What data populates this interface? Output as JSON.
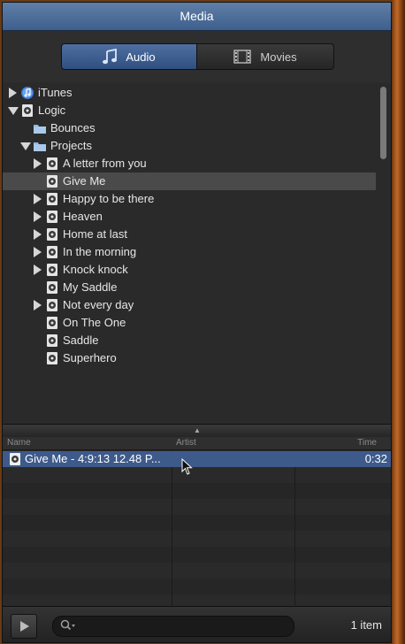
{
  "window": {
    "title": "Media"
  },
  "tabs": {
    "audio_label": "Audio",
    "movies_label": "Movies",
    "selected": "Audio"
  },
  "tree": {
    "items": [
      {
        "label": "iTunes",
        "expander": "collapsed",
        "icon": "itunes-icon",
        "depth": 0
      },
      {
        "label": "Logic",
        "expander": "expanded",
        "icon": "logic-doc-icon",
        "depth": 0
      },
      {
        "label": "Bounces",
        "expander": "none",
        "icon": "folder-icon",
        "depth": 1
      },
      {
        "label": "Projects",
        "expander": "expanded",
        "icon": "folder-icon",
        "depth": 1
      },
      {
        "label": "A letter from you",
        "expander": "collapsed",
        "icon": "logic-doc-icon",
        "depth": 2
      },
      {
        "label": "Give Me",
        "expander": "none",
        "icon": "logic-doc-icon",
        "depth": 2,
        "selected": true
      },
      {
        "label": "Happy to be there",
        "expander": "collapsed",
        "icon": "logic-doc-icon",
        "depth": 2
      },
      {
        "label": "Heaven",
        "expander": "collapsed",
        "icon": "logic-doc-icon",
        "depth": 2
      },
      {
        "label": "Home at last",
        "expander": "collapsed",
        "icon": "logic-doc-icon",
        "depth": 2
      },
      {
        "label": "In the morning",
        "expander": "collapsed",
        "icon": "logic-doc-icon",
        "depth": 2
      },
      {
        "label": "Knock knock",
        "expander": "collapsed",
        "icon": "logic-doc-icon",
        "depth": 2
      },
      {
        "label": "My Saddle",
        "expander": "none",
        "icon": "logic-doc-icon",
        "depth": 2
      },
      {
        "label": "Not every day",
        "expander": "collapsed",
        "icon": "logic-doc-icon",
        "depth": 2
      },
      {
        "label": "On The One",
        "expander": "none",
        "icon": "logic-doc-icon",
        "depth": 2
      },
      {
        "label": "Saddle",
        "expander": "none",
        "icon": "logic-doc-icon",
        "depth": 2
      },
      {
        "label": "Superhero",
        "expander": "none",
        "icon": "logic-doc-icon",
        "depth": 2
      }
    ]
  },
  "list": {
    "columns": [
      "Name",
      "Artist",
      "Time"
    ],
    "rows": [
      {
        "name": "Give Me - 4:9:13 12.48 P...",
        "artist": "",
        "time": "0:32",
        "selected": true
      }
    ]
  },
  "footer": {
    "search_value": "",
    "item_count": "1 item"
  },
  "colors": {
    "accent": "#3d5a8a",
    "title_bar": "#4f6f9a",
    "panel_bg": "#2a2a2a"
  }
}
